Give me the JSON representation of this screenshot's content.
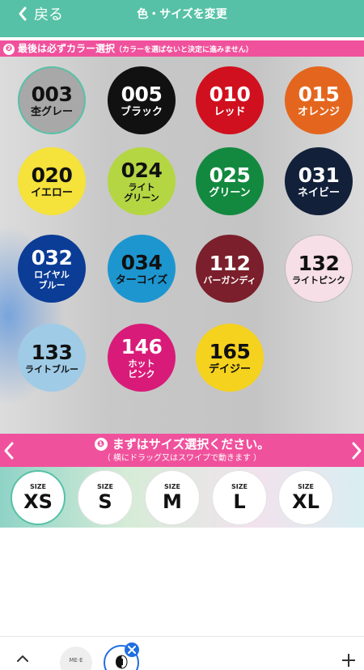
{
  "header": {
    "back_label": "戻る",
    "title": "色・サイズを変更"
  },
  "color_section": {
    "step_number": "❷",
    "heading": "最後は必ずカラー選択",
    "note": "（カラーを選ばないと決定に進みません）"
  },
  "colors": [
    {
      "code": "003",
      "name": "杢グレー",
      "bg": "#a8a8a8",
      "fg": "#111111"
    },
    {
      "code": "005",
      "name": "ブラック",
      "bg": "#111111",
      "fg": "#ffffff"
    },
    {
      "code": "010",
      "name": "レッド",
      "bg": "#d0101e",
      "fg": "#ffffff"
    },
    {
      "code": "015",
      "name": "オレンジ",
      "bg": "#e4661e",
      "fg": "#ffffff"
    },
    {
      "code": "020",
      "name": "イエロー",
      "bg": "#f5e23a",
      "fg": "#111111"
    },
    {
      "code": "024",
      "name": "ライト\nグリーン",
      "bg": "#b4d643",
      "fg": "#111111"
    },
    {
      "code": "025",
      "name": "グリーン",
      "bg": "#13893f",
      "fg": "#ffffff"
    },
    {
      "code": "031",
      "name": "ネイビー",
      "bg": "#12203a",
      "fg": "#ffffff"
    },
    {
      "code": "032",
      "name": "ロイヤル\nブルー",
      "bg": "#0b3c96",
      "fg": "#ffffff"
    },
    {
      "code": "034",
      "name": "ターコイズ",
      "bg": "#1d96d0",
      "fg": "#111111"
    },
    {
      "code": "112",
      "name": "バーガンディ",
      "bg": "#7a1f2b",
      "fg": "#ffffff"
    },
    {
      "code": "132",
      "name": "ライトピンク",
      "bg": "#f6dfe6",
      "fg": "#111111"
    },
    {
      "code": "133",
      "name": "ライトブルー",
      "bg": "#9fcbe6",
      "fg": "#111111"
    },
    {
      "code": "146",
      "name": "ホット\nピンク",
      "bg": "#d81b79",
      "fg": "#ffffff"
    },
    {
      "code": "165",
      "name": "デイジー",
      "bg": "#f5d21e",
      "fg": "#111111"
    }
  ],
  "size_section": {
    "step_number": "❶",
    "heading": "まずはサイズ選択ください。",
    "hint": "（ 横にドラッグ又はスワイプで動きます ）"
  },
  "sizes": [
    {
      "caption": "SIZE",
      "value": "XS"
    },
    {
      "caption": "SIZE",
      "value": "S"
    },
    {
      "caption": "SIZE",
      "value": "M"
    },
    {
      "caption": "SIZE",
      "value": "L"
    },
    {
      "caption": "SIZE",
      "value": "XL"
    }
  ],
  "bottom_bar": {
    "thumb_label": "ME·E"
  },
  "theme": {
    "accent_green": "#56c1a6",
    "accent_pink": "#f0519c",
    "active_blue": "#1e6fe0"
  }
}
